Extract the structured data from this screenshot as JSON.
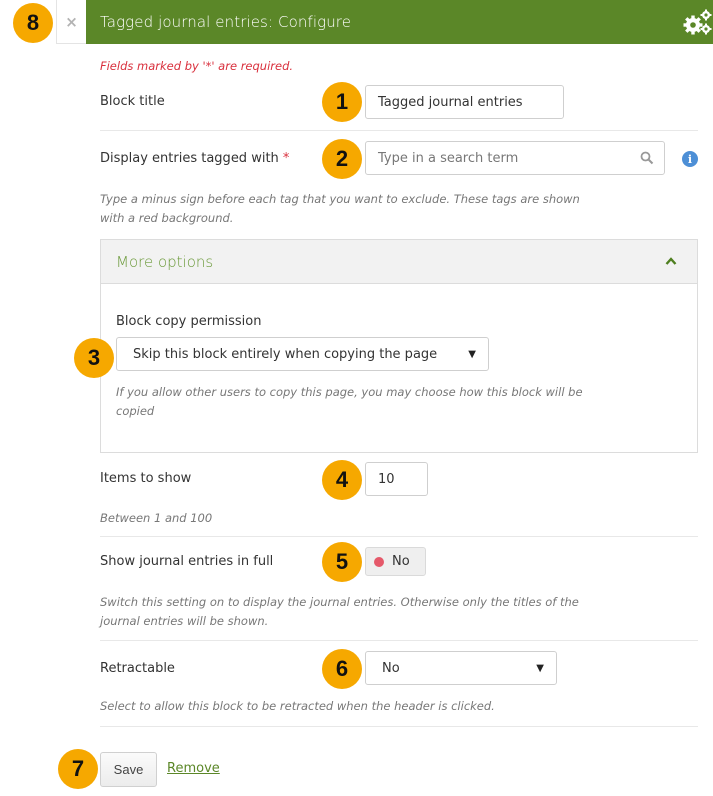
{
  "header": {
    "title": "Tagged journal entries: Configure",
    "close_icon": "×",
    "brand_color": "#5b8728"
  },
  "required_note": "Fields marked by '*' are required.",
  "fields": {
    "block_title": {
      "label": "Block title",
      "value": "Tagged journal entries"
    },
    "tags": {
      "label": "Display entries tagged with",
      "required_mark": "*",
      "placeholder": "Type in a search term",
      "help": "Type a minus sign before each tag that you want to exclude. These tags are shown with a red background."
    },
    "more_options": {
      "title": "More options",
      "copy_permission": {
        "label": "Block copy permission",
        "value": "Skip this block entirely when copying the page",
        "help": "If you allow other users to copy this page, you may choose how this block will be copied"
      }
    },
    "items_to_show": {
      "label": "Items to show",
      "value": "10",
      "help": "Between 1 and 100"
    },
    "show_full": {
      "label": "Show journal entries in full",
      "value": "No",
      "help": "Switch this setting on to display the journal entries. Otherwise only the titles of the journal entries will be shown."
    },
    "retractable": {
      "label": "Retractable",
      "value": "No",
      "help": "Select to allow this block to be retracted when the header is clicked."
    }
  },
  "actions": {
    "save": "Save",
    "remove": "Remove"
  },
  "callouts": [
    "1",
    "2",
    "3",
    "4",
    "5",
    "6",
    "7",
    "8"
  ],
  "caret": "▼"
}
